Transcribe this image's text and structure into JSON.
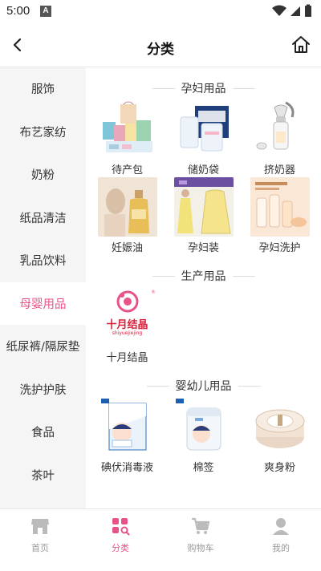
{
  "status_bar": {
    "time": "5:00",
    "notification_glyph": "A"
  },
  "header": {
    "title": "分类",
    "back_icon": "chevron-left-icon",
    "home_icon": "home-icon"
  },
  "sidebar": {
    "active_index": 5,
    "items": [
      {
        "label": "服饰"
      },
      {
        "label": "布艺家纺"
      },
      {
        "label": "奶粉"
      },
      {
        "label": "纸品清洁"
      },
      {
        "label": "乳品饮料"
      },
      {
        "label": "母婴用品"
      },
      {
        "label": "纸尿裤/隔尿垫"
      },
      {
        "label": "洗护护肤"
      },
      {
        "label": "食品"
      },
      {
        "label": "茶叶"
      }
    ]
  },
  "sections": [
    {
      "title": "孕妇用品",
      "items": [
        {
          "label": "待产包",
          "icon": "maternity-kit-image"
        },
        {
          "label": "储奶袋",
          "icon": "breast-milk-bag-image"
        },
        {
          "label": "挤奶器",
          "icon": "breast-pump-image"
        },
        {
          "label": "妊娠油",
          "icon": "pregnancy-oil-image"
        },
        {
          "label": "孕妇装",
          "icon": "maternity-dress-image"
        },
        {
          "label": "孕妇洗护",
          "icon": "maternity-care-image"
        }
      ]
    },
    {
      "title": "生产用品",
      "items": [
        {
          "label": "十月结晶",
          "icon": "shiyuejiejing-logo",
          "logo_text": "十月结晶",
          "logo_sub": "shiyuejiejing"
        }
      ]
    },
    {
      "title": "婴幼儿用品",
      "items": [
        {
          "label": "碘伏消毒液",
          "icon": "iodine-disinfectant-image"
        },
        {
          "label": "棉签",
          "icon": "cotton-swab-image"
        },
        {
          "label": "爽身粉",
          "icon": "baby-powder-image"
        }
      ]
    }
  ],
  "bottom_nav": {
    "active_index": 1,
    "items": [
      {
        "label": "首页",
        "icon": "store-icon"
      },
      {
        "label": "分类",
        "icon": "category-icon"
      },
      {
        "label": "购物车",
        "icon": "cart-icon"
      },
      {
        "label": "我的",
        "icon": "user-icon"
      }
    ]
  },
  "colors": {
    "accent": "#e8528a",
    "sidebar_bg": "#f5f5f5",
    "inactive": "#999999"
  }
}
